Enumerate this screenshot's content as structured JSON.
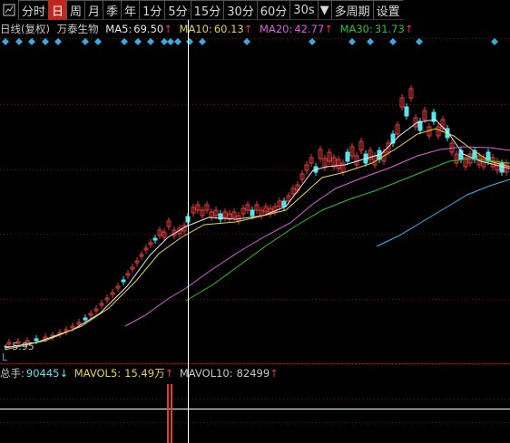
{
  "toolbar": {
    "periods": [
      "分时",
      "日",
      "周",
      "月",
      "季",
      "年",
      "1分",
      "5分",
      "15分",
      "30分",
      "60分",
      "30s",
      "多周期",
      "设置"
    ],
    "active_index": 1
  },
  "legend": {
    "period_type": "日线(复权)",
    "stock_name": "万泰生物",
    "ma5": {
      "label": "MA5:",
      "value": "69.50",
      "arrow": "↑",
      "color": "#e8e8e8"
    },
    "ma10": {
      "label": "MA10:",
      "value": "60.13",
      "arrow": "↑",
      "color": "#e6d44a"
    },
    "ma20": {
      "label": "MA20:",
      "value": "42.77",
      "arrow": "↑",
      "color": "#e060e0"
    },
    "ma30": {
      "label": "MA30:",
      "value": "31.73",
      "arrow": "↑",
      "color": "#30c030"
    }
  },
  "price_chart": {
    "low_marker_label": "5.95",
    "l_label": "L"
  },
  "volume": {
    "total_label": "总手:",
    "total_value": "90445",
    "total_arrow": "↓",
    "mavol5_label": "MAVOL5:",
    "mavol5_value": "15.49万",
    "mavol5_arrow": "↑",
    "mavol10_label": "MAVOL10:",
    "mavol10_value": "82499",
    "mavol10_arrow": "↑"
  },
  "colors": {
    "up": "#e03c3c",
    "down": "#54e6ee",
    "ma60": "#36b7ee",
    "cursor": "#ffffff",
    "grid": "#7a0b0b",
    "diamond": "#3fa7e0"
  }
}
